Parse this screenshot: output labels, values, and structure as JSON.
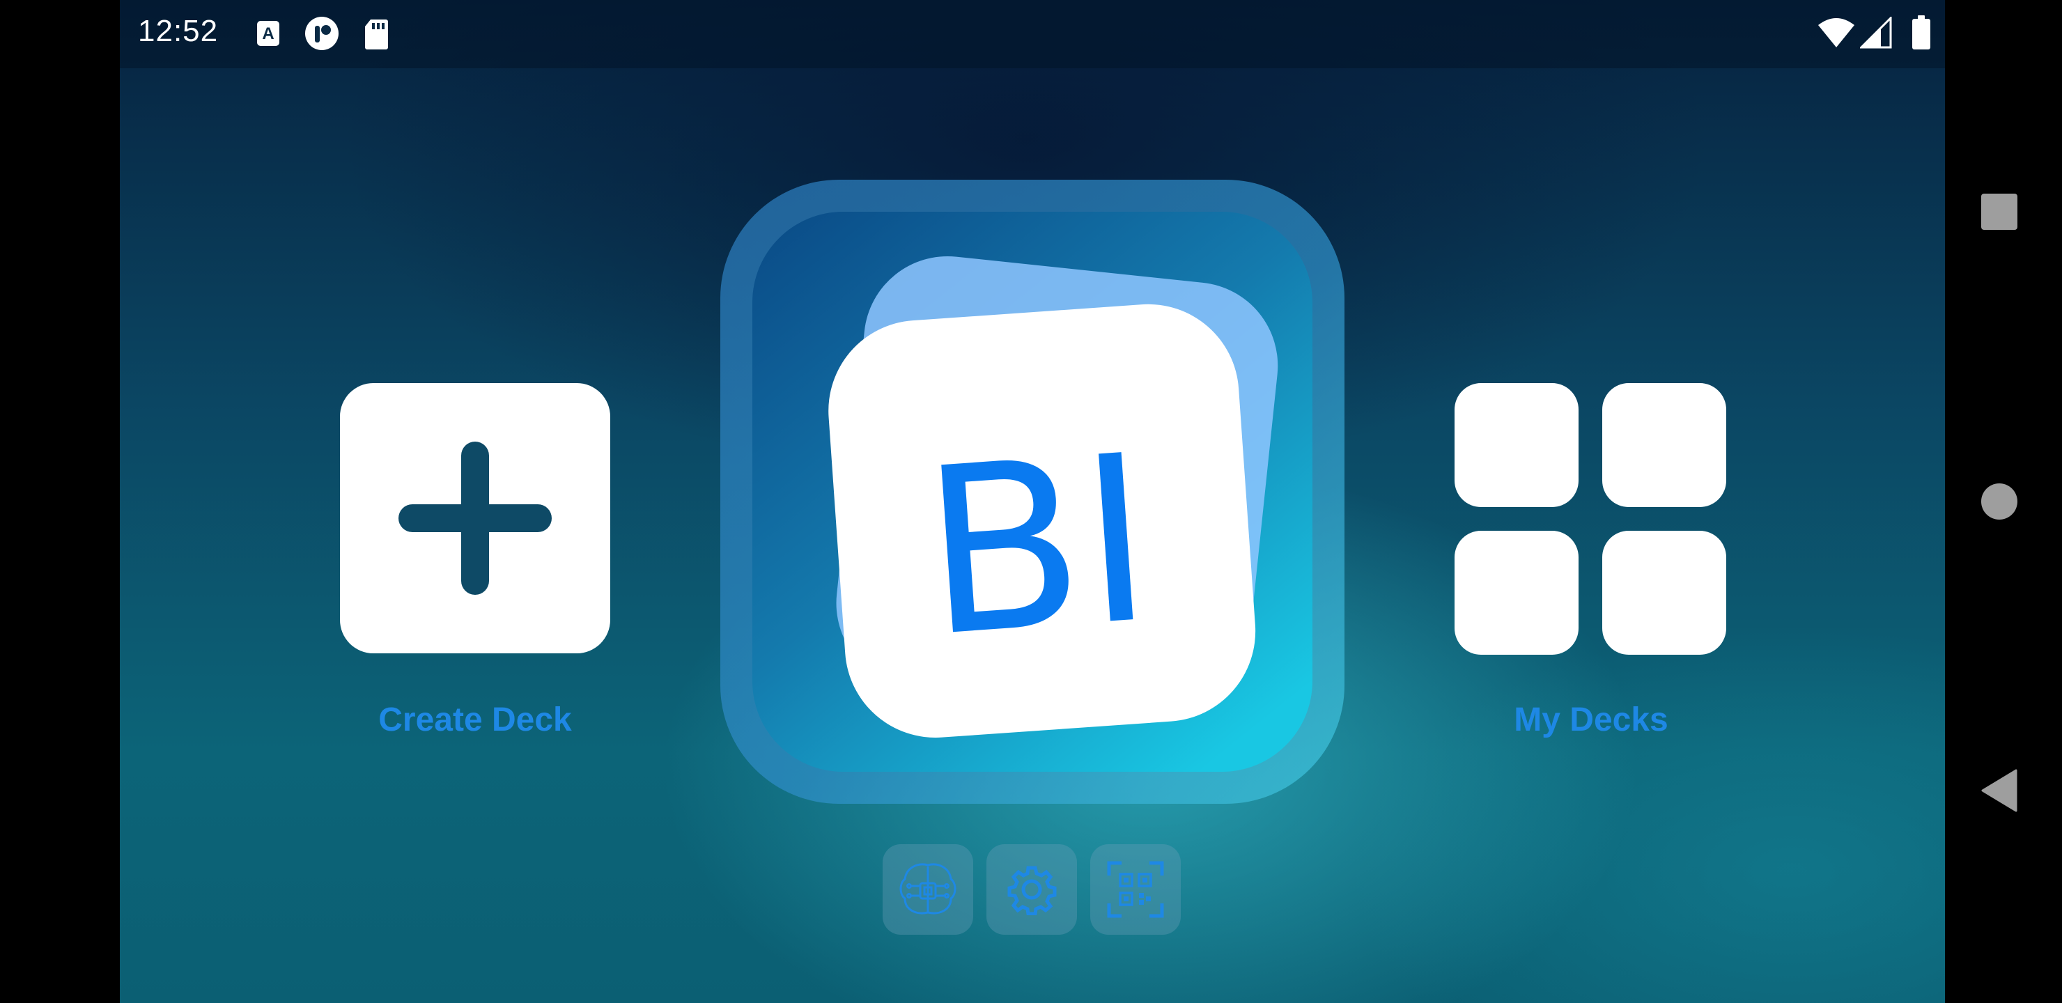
{
  "status_bar": {
    "time": "12:52",
    "icons": [
      "text-a-icon",
      "app-badge-icon",
      "sd-card-icon",
      "wifi-icon",
      "signal-icon",
      "battery-icon"
    ]
  },
  "main": {
    "create_deck": {
      "label": "Create Deck",
      "icon": "plus-icon"
    },
    "my_decks": {
      "label": "My Decks",
      "icon": "grid-icon"
    },
    "logo": {
      "text": "BI"
    },
    "bottom_buttons": [
      {
        "icon": "brain-chip-icon"
      },
      {
        "icon": "gear-icon"
      },
      {
        "icon": "qr-scan-icon"
      }
    ]
  },
  "nav_bar": {
    "buttons": [
      "recents-square-icon",
      "home-circle-icon",
      "back-triangle-icon"
    ]
  },
  "colors": {
    "accent": "#1E88E5",
    "logo_text": "#0A7AF0",
    "plus": "#0E4A66",
    "tile": "#FFFFFF"
  }
}
